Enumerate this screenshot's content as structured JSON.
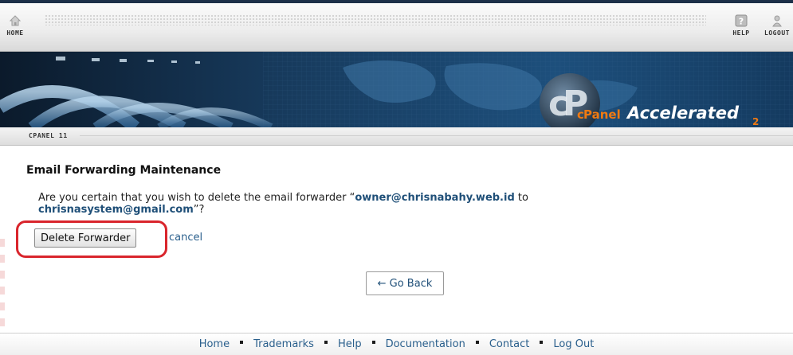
{
  "nav": {
    "home_label": "HOME",
    "help_label": "HELP",
    "logout_label": "LOGOUT"
  },
  "banner": {
    "brand_c": "c",
    "brand_panel": "Panel",
    "brand_accel": "Accelerated",
    "brand_sub": "2"
  },
  "breadcrumb": {
    "label": "CPANEL 11"
  },
  "page": {
    "title": "Email Forwarding Maintenance",
    "question_prefix": "Are you certain that you wish to delete the email forwarder “",
    "forwarder": "owner@chrisnabahy.web.id",
    "question_mid": " to",
    "destination": "chrisnasystem@gmail.com",
    "question_suffix": "”?",
    "delete_button": "Delete Forwarder",
    "cancel_link": "cancel",
    "go_back_button": "← Go Back"
  },
  "footer": {
    "links": [
      "Home",
      "Trademarks",
      "Help",
      "Documentation",
      "Contact",
      "Log Out"
    ]
  },
  "colors": {
    "link": "#2a5f8c",
    "highlight": "#d9252c",
    "banner_orange": "#f07a12"
  },
  "icons": [
    "home-icon",
    "help-icon",
    "logout-icon",
    "cpanel-logo"
  ]
}
